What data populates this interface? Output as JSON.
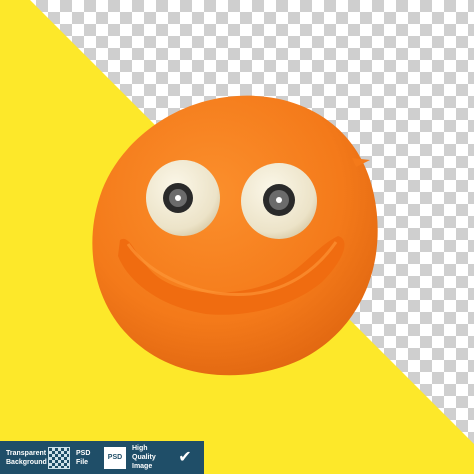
{
  "colors": {
    "background_yellow": "#fde82a",
    "smiley_orange": "#f47a1a",
    "banner_blue": "#1f4e68"
  },
  "banner": {
    "transparent_line1": "Transparent",
    "transparent_line2": "Background",
    "psd_line1": "PSD",
    "psd_line2": "File",
    "psd_icon_text": "PSD",
    "quality_line1": "High Quality",
    "quality_line2": "Image"
  },
  "icons": {
    "transparent": "checkerboard-icon",
    "psd": "psd-file-icon",
    "quality": "checkmark-icon"
  }
}
